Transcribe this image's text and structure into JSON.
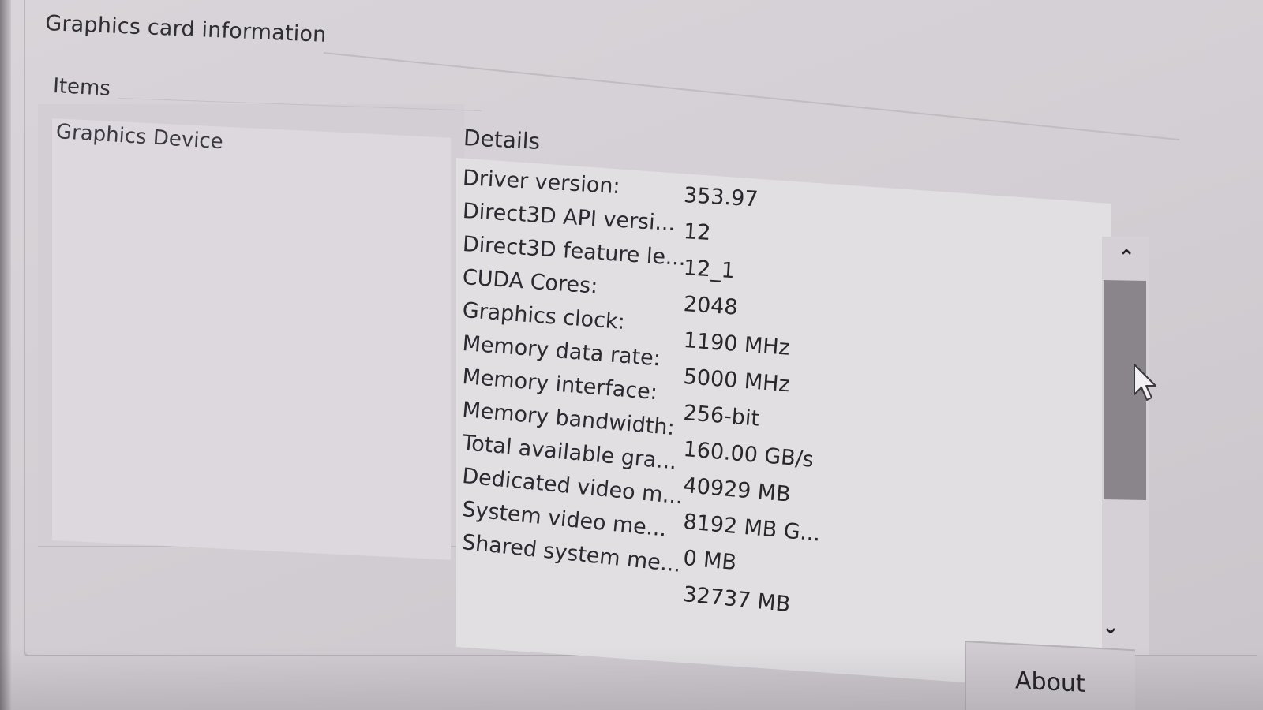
{
  "window": {
    "group_title": "Graphics card information"
  },
  "items_panel": {
    "heading": "Items",
    "entries": [
      "Graphics Device"
    ]
  },
  "details_panel": {
    "heading": "Details",
    "rows": [
      {
        "label": "Driver version:",
        "value": "353.97"
      },
      {
        "label": "Direct3D API versi...",
        "value": "12"
      },
      {
        "label": "Direct3D feature le...",
        "value": "12_1"
      },
      {
        "label": "CUDA Cores:",
        "value": "2048"
      },
      {
        "label": "Graphics clock:",
        "value": "1190 MHz"
      },
      {
        "label": "Memory data rate:",
        "value": "5000 MHz"
      },
      {
        "label": "Memory interface:",
        "value": "256-bit"
      },
      {
        "label": "Memory bandwidth:",
        "value": "160.00 GB/s"
      },
      {
        "label": "Total available gra...",
        "value": "40929 MB"
      },
      {
        "label": "Dedicated video m...",
        "value": "8192 MB G..."
      },
      {
        "label": "System video me...",
        "value": "0 MB"
      },
      {
        "label": "Shared system me...",
        "value": "32737 MB"
      }
    ]
  },
  "scrollbar": {
    "up_glyph": "⌃",
    "down_glyph": "⌄"
  },
  "buttons": {
    "about_label": "About"
  },
  "colors": {
    "background": "#d6d2d7",
    "list_background": "#e2dfe3",
    "scroll_thumb": "#8a858b",
    "text": "#2a2a30"
  }
}
